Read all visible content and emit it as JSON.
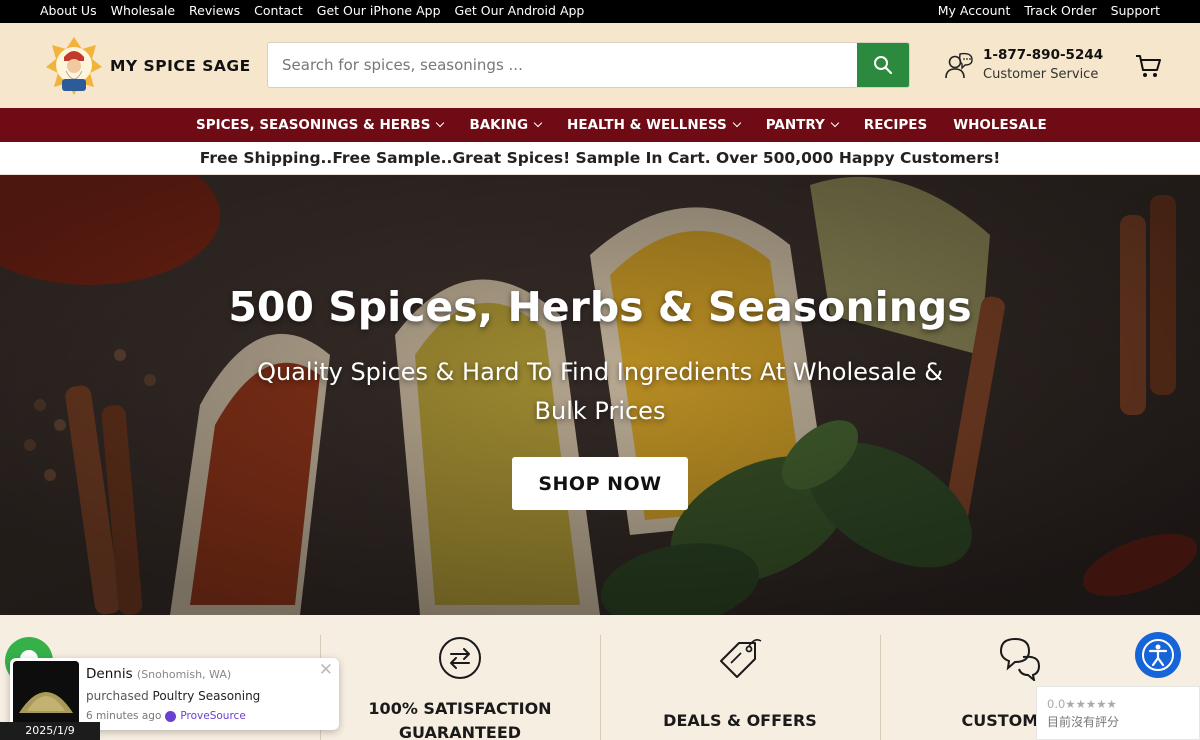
{
  "topbar": {
    "left_links": [
      "About Us",
      "Wholesale",
      "Reviews",
      "Contact",
      "Get Our iPhone App",
      "Get Our Android App"
    ],
    "right_links": [
      "My Account",
      "Track Order",
      "Support"
    ]
  },
  "header": {
    "logo_text": "MY SPICE SAGE",
    "search_placeholder": "Search for spices, seasonings ...",
    "phone": "1-877-890-5244",
    "phone_label": "Customer Service"
  },
  "nav": {
    "items": [
      {
        "label": "SPICES, SEASONINGS & HERBS",
        "dropdown": true
      },
      {
        "label": "BAKING",
        "dropdown": true
      },
      {
        "label": "HEALTH & WELLNESS",
        "dropdown": true
      },
      {
        "label": "PANTRY",
        "dropdown": true
      },
      {
        "label": "RECIPES",
        "dropdown": false
      },
      {
        "label": "WHOLESALE",
        "dropdown": false
      }
    ]
  },
  "promo_text": "Free Shipping..Free Sample..Great Spices! Sample In Cart. Over 500,000 Happy Customers!",
  "hero": {
    "title": "500 Spices, Herbs & Seasonings",
    "subtitle": "Quality Spices & Hard To Find Ingredients At Wholesale & Bulk Prices",
    "cta": "SHOP NOW"
  },
  "features": [
    {
      "label": "",
      "icon": "truck-icon"
    },
    {
      "label": "100% SATISFACTION GUARANTEED",
      "icon": "exchange-icon"
    },
    {
      "label": "DEALS & OFFERS",
      "icon": "price-tag-icon"
    },
    {
      "label": "CUSTOMER S",
      "icon": "chat-icon"
    }
  ],
  "social_proof": {
    "name": "Dennis",
    "location": "(Snohomish, WA)",
    "action": "purchased",
    "product": "Poultry Seasoning",
    "time": "6 minutes ago",
    "brand": "ProveSource"
  },
  "date_stamp": "2025/1/9",
  "rating_widget": {
    "score": "0.0★★★★★",
    "text": "目前沒有評分"
  },
  "colors": {
    "topbar": "#000000",
    "header_bg": "#f5e6cc",
    "nav_bg": "#6e0b14",
    "search_button": "#2b8a3e",
    "features_bg": "#f7eee2",
    "accessibility": "#1565d8",
    "chat": "#36b14a"
  }
}
